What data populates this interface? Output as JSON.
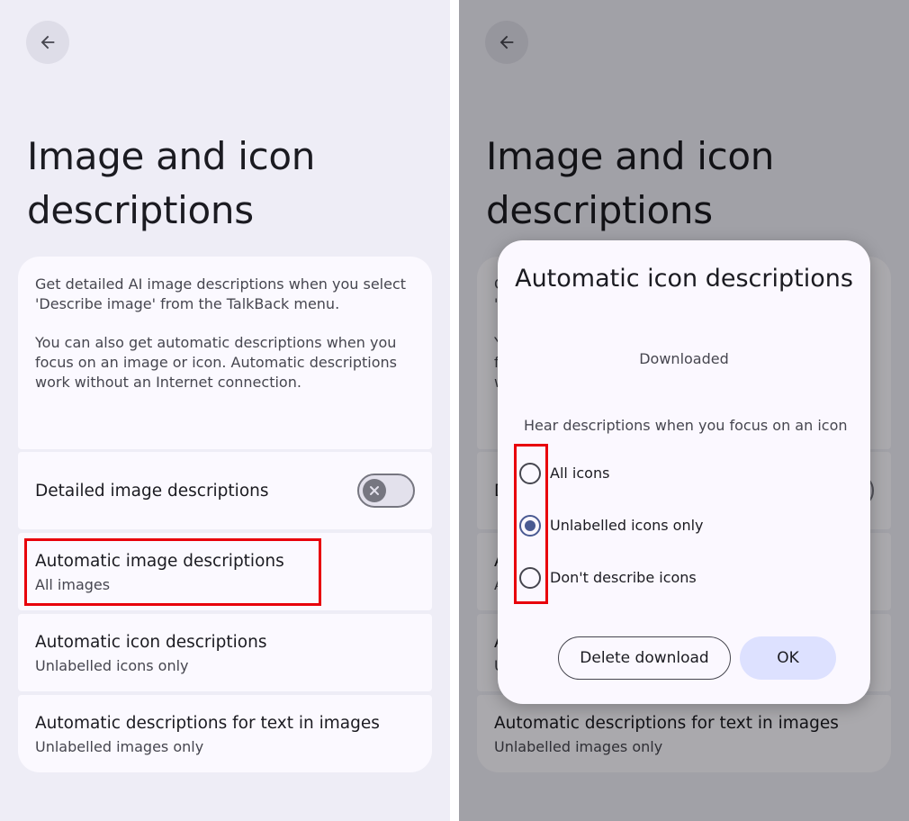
{
  "page": {
    "title": "Image and icon descriptions",
    "back_icon": "arrow-left-icon",
    "intro_p1": "Get detailed AI image descriptions when you select 'Describe image' from the TalkBack menu.",
    "intro_p2": "You can also get automatic descriptions when you focus on an image or icon. Automatic descriptions work without an Internet connection.",
    "toggle_icon": "close-icon",
    "settings": [
      {
        "title": "Detailed image descriptions",
        "toggle": "off"
      },
      {
        "title": "Automatic image descriptions",
        "subtitle": "All images"
      },
      {
        "title": "Automatic icon descriptions",
        "subtitle": "Unlabelled icons only"
      },
      {
        "title": "Automatic descriptions for text in images",
        "subtitle": "Unlabelled images only"
      }
    ]
  },
  "dialog": {
    "title": "Automatic icon descriptions",
    "status": "Downloaded",
    "prompt": "Hear descriptions when you focus on an icon",
    "options": [
      {
        "label": "All icons",
        "selected": false
      },
      {
        "label": "Unlabelled icons only",
        "selected": true
      },
      {
        "label": "Don't describe icons",
        "selected": false
      }
    ],
    "delete_label": "Delete download",
    "ok_label": "OK"
  },
  "colors": {
    "highlight": "#e8000b",
    "accent": "#4a5a92",
    "background": "#eeedf6",
    "card": "#fbf9ff"
  }
}
